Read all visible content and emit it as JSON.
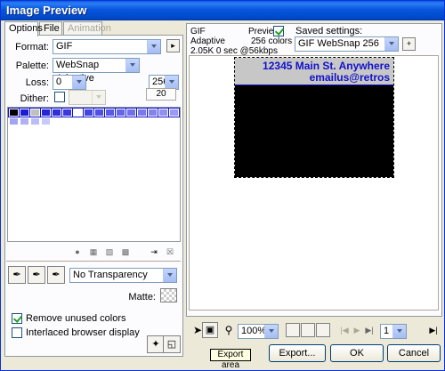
{
  "window": {
    "title": "Image Preview"
  },
  "tabs": [
    {
      "label": "Options"
    },
    {
      "label": "File"
    },
    {
      "label": "Animation"
    }
  ],
  "options": {
    "format_label": "Format:",
    "format_value": "GIF",
    "palette_label": "Palette:",
    "palette_value": "WebSnap Adaptive",
    "loss_label": "Loss:",
    "loss_value": "0",
    "colors_value": "256",
    "colors_count": "20",
    "dither_label": "Dither:",
    "transparency_value": "No Transparency",
    "matte_label": "Matte:",
    "remove_unused_label": "Remove unused colors",
    "interlaced_label": "Interlaced browser display"
  },
  "preview": {
    "format": "GIF",
    "palette": "Adaptive",
    "stats": "2.05K  0 sec @56kbps",
    "preview_label": "Preview",
    "colors_label": "256 colors",
    "saved_settings_label": "Saved settings:",
    "saved_settings_value": "GIF WebSnap 256",
    "address_line1": "12345 Main St. Anywhere",
    "address_line2": "emailus@retros"
  },
  "bottom_toolbar": {
    "zoom_value": "100%",
    "frame_value": "1",
    "tooltip": "Export area"
  },
  "buttons": {
    "export": "Export...",
    "ok": "OK",
    "cancel": "Cancel"
  },
  "colors": {
    "title_bar": "#0a5ae0",
    "palette_selection": "#1111cc",
    "text_blue": "#1111cc"
  }
}
